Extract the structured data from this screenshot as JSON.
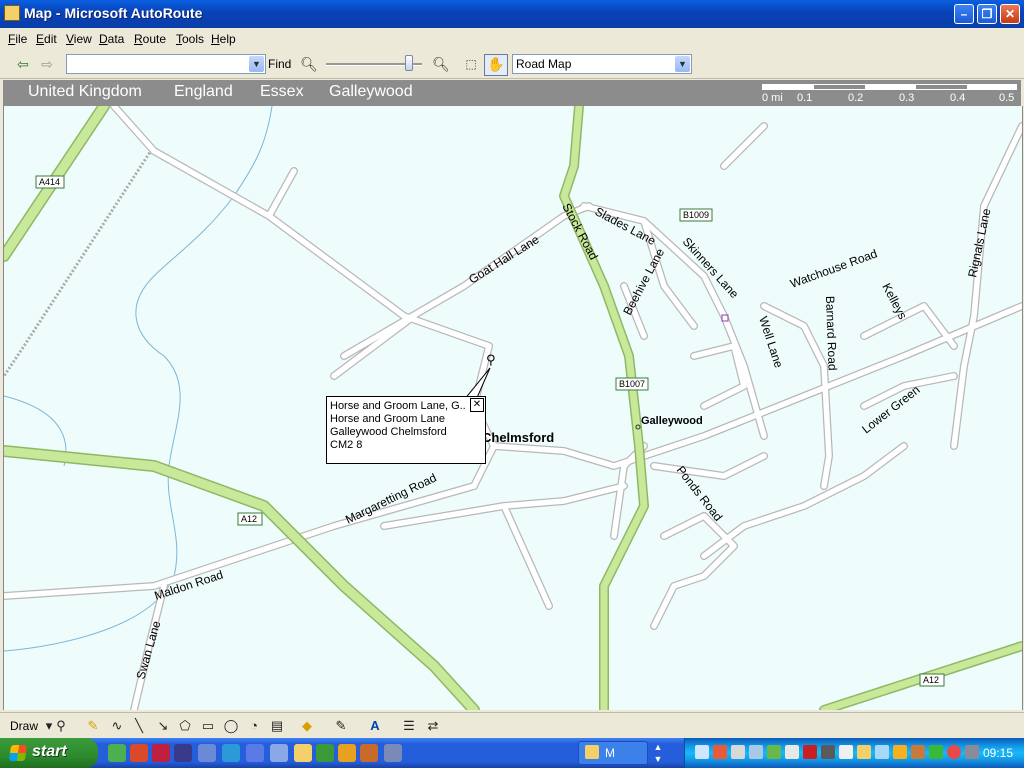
{
  "window": {
    "title": "Map - Microsoft AutoRoute"
  },
  "menubar": {
    "items": [
      {
        "label": "File",
        "key": "F",
        "rest": "ile"
      },
      {
        "label": "Edit",
        "key": "E",
        "rest": "dit"
      },
      {
        "label": "View",
        "key": "V",
        "rest": "iew"
      },
      {
        "label": "Data",
        "key": "D",
        "rest": "ata"
      },
      {
        "label": "Route",
        "key": "R",
        "rest": "oute"
      },
      {
        "label": "Tools",
        "key": "T",
        "rest": "ools"
      },
      {
        "label": "Help",
        "key": "H",
        "rest": "elp"
      }
    ]
  },
  "toolbar": {
    "find_value": "",
    "find_label": "Find",
    "zoom_level": 0.85,
    "map_style": "Road Map"
  },
  "breadcrumb": [
    "United Kingdom",
    "England",
    "Essex",
    "Galleywood"
  ],
  "scale": {
    "labels": [
      "0 mi",
      "0.1",
      "0.2",
      "0.3",
      "0.4",
      "0.5"
    ]
  },
  "map": {
    "colors": {
      "background": "#eefdfb",
      "minor_road": "#ffffff",
      "road_casing": "#b8b8b8",
      "major_road": "#c8e89a",
      "major_casing": "#8fb865",
      "water": "#7cb6d8"
    },
    "road_labels": [
      "Goat Hall Lane",
      "Stock Road",
      "Slades Lane",
      "Skinners Lane",
      "Beehive Lane",
      "Watchouse Road",
      "Rignals Lane",
      "Kelleys",
      "Barnard Road",
      "Well Lane",
      "Lower Green",
      "Ponds Road",
      "Margaretting Road",
      "Maldon Road",
      "Swan Lane"
    ],
    "road_shields": [
      "A414",
      "B1009",
      "B1007",
      "A12",
      "A12"
    ],
    "places": [
      "Chelmsford",
      "Galleywood"
    ]
  },
  "popup": {
    "lines": [
      "Horse and Groom Lane, G...",
      "Horse and Groom Lane",
      "Galleywood Chelmsford",
      "CM2 8"
    ],
    "close": "✕"
  },
  "drawbar": {
    "draw_label": "Draw"
  },
  "taskbar": {
    "start_label": "start",
    "task_label": "M",
    "clock": "09:15"
  }
}
